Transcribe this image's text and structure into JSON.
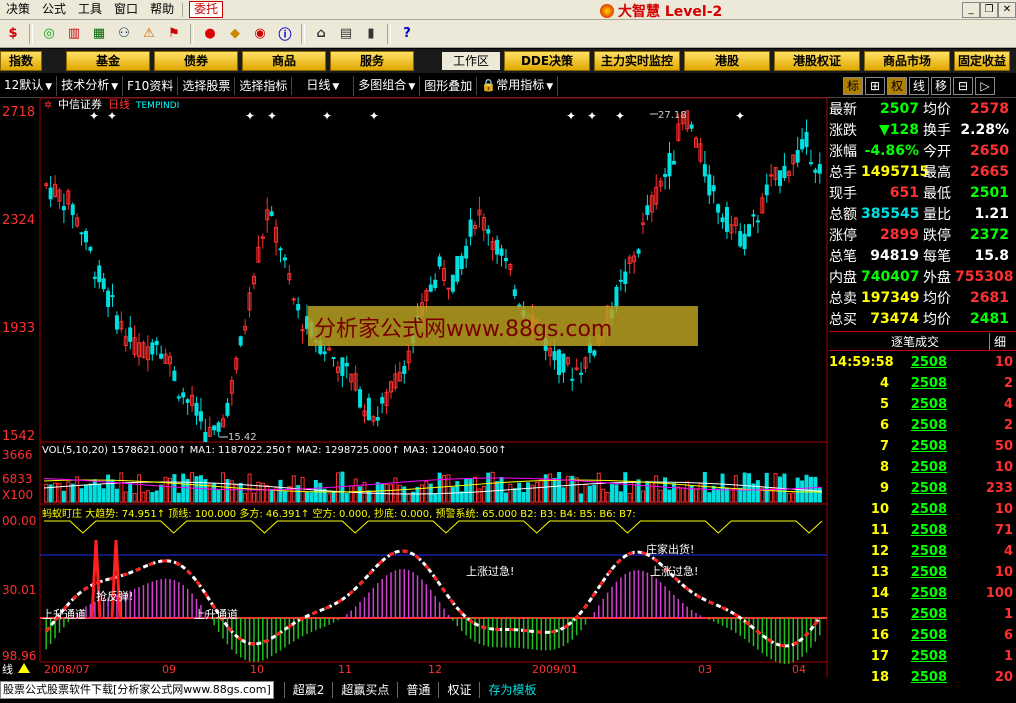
{
  "menubar": {
    "items": [
      "决策",
      "公式",
      "工具",
      "窗口",
      "帮助"
    ],
    "weituo": "委托",
    "brand": "大智慧 Level-2"
  },
  "navbar": {
    "buttons": [
      "指数",
      "基金",
      "债券",
      "商品",
      "服务"
    ],
    "workspace": "工作区",
    "tools": [
      "DDE决策",
      "主力实时监控",
      "港股",
      "港股权证",
      "商品市场",
      "固定收益"
    ]
  },
  "subbar": {
    "items": [
      "12默认",
      "技术分析",
      "F10资料",
      "选择股票",
      "选择指标",
      "日线",
      "多图组合",
      "图形叠加",
      "常用指标"
    ],
    "right_tabs": [
      "标",
      "⊞",
      "权",
      "线",
      "移",
      "⊟",
      "▷"
    ]
  },
  "chart": {
    "stock_name": "中信证券",
    "period": "日线",
    "indicator": "TEMPINDI",
    "y_labels": [
      "2718",
      "2324",
      "1933",
      "1542"
    ],
    "high_label": "27.18",
    "low_label": "15.42",
    "watermark": "分析家公式网www.88gs.com",
    "vol_line": "VOL(5,10,20)  1578621.000↑  MA1: 1187022.250↑  MA2: 1298725.000↑  MA3: 1204040.500↑",
    "vol_y_labels": [
      "3666",
      "6833",
      "X100"
    ],
    "ind_line": "蚂蚁盯庄  大趋势: 74.951↑  顶线: 100.000  多方: 46.391↑  空方: 0.000, 抄底: 0.000, 预警系统: 65.000  B2:  B3:  B4:  B5:  B6:  B7:",
    "ind_y_labels": [
      "00.00",
      "30.01",
      "98.96"
    ],
    "annotations": [
      "抢反弹!",
      "上升通道",
      "上升通道",
      "上涨过急!",
      "庄家出货!",
      "上涨过急!"
    ],
    "x_labels": [
      "2008/07",
      "09",
      "10",
      "11",
      "12",
      "2009/01",
      "03",
      "04"
    ],
    "x_left": "线"
  },
  "quote": {
    "rows": [
      {
        "l1": "最新",
        "v1": "2507",
        "c1": "dn",
        "l2": "均价",
        "v2": "2578",
        "c2": "up"
      },
      {
        "l1": "涨跌",
        "v1": "▼128",
        "c1": "dn",
        "l2": "换手",
        "v2": "2.28%",
        "c2": "wh"
      },
      {
        "l1": "涨幅",
        "v1": "-4.86%",
        "c1": "dn",
        "l2": "今开",
        "v2": "2650",
        "c2": "up"
      },
      {
        "l1": "总手",
        "v1": "1495715",
        "c1": "ye",
        "l2": "最高",
        "v2": "2665",
        "c2": "up"
      },
      {
        "l1": "现手",
        "v1": "651",
        "c1": "up",
        "l2": "最低",
        "v2": "2501",
        "c2": "dn"
      },
      {
        "l1": "总额",
        "v1": "385545",
        "c1": "cy",
        "l2": "量比",
        "v2": "1.21",
        "c2": "wh"
      },
      {
        "l1": "涨停",
        "v1": "2899",
        "c1": "up",
        "l2": "跌停",
        "v2": "2372",
        "c2": "dn"
      },
      {
        "l1": "总笔",
        "v1": "94819",
        "c1": "wh",
        "l2": "每笔",
        "v2": "15.8",
        "c2": "wh"
      },
      {
        "l1": "内盘",
        "v1": "740407",
        "c1": "dn",
        "l2": "外盘",
        "v2": "755308",
        "c2": "up"
      },
      {
        "l1": "总卖",
        "v1": "197349",
        "c1": "ye",
        "l2": "均价",
        "v2": "2681",
        "c2": "up"
      },
      {
        "l1": "总买",
        "v1": "73474",
        "c1": "ye",
        "l2": "均价",
        "v2": "2481",
        "c2": "dn"
      }
    ],
    "tick_title": "逐笔成交",
    "tick_tab": "细"
  },
  "ticks": [
    {
      "t": "14:59:58",
      "p": "2508",
      "q": "10",
      "c": "up"
    },
    {
      "t": "4",
      "p": "2508",
      "q": "2",
      "c": "up"
    },
    {
      "t": "5",
      "p": "2508",
      "q": "4",
      "c": "up"
    },
    {
      "t": "6",
      "p": "2508",
      "q": "2",
      "c": "up"
    },
    {
      "t": "7",
      "p": "2508",
      "q": "50",
      "c": "up"
    },
    {
      "t": "8",
      "p": "2508",
      "q": "10",
      "c": "up"
    },
    {
      "t": "9",
      "p": "2508",
      "q": "233",
      "c": "up"
    },
    {
      "t": "10",
      "p": "2508",
      "q": "10",
      "c": "up"
    },
    {
      "t": "11",
      "p": "2508",
      "q": "71",
      "c": "up"
    },
    {
      "t": "12",
      "p": "2508",
      "q": "4",
      "c": "up"
    },
    {
      "t": "13",
      "p": "2508",
      "q": "10",
      "c": "up"
    },
    {
      "t": "14",
      "p": "2508",
      "q": "100",
      "c": "up"
    },
    {
      "t": "15",
      "p": "2508",
      "q": "1",
      "c": "up"
    },
    {
      "t": "16",
      "p": "2508",
      "q": "6",
      "c": "up"
    },
    {
      "t": "17",
      "p": "2508",
      "q": "1",
      "c": "up"
    },
    {
      "t": "18",
      "p": "2508",
      "q": "20",
      "c": "up"
    }
  ],
  "bottom": {
    "ad": "股票公式股票软件下载[分析家公式网www.88gs.com]",
    "tabs": [
      "超赢2",
      "超赢买点",
      "普通",
      "权证",
      "存为模板"
    ]
  }
}
